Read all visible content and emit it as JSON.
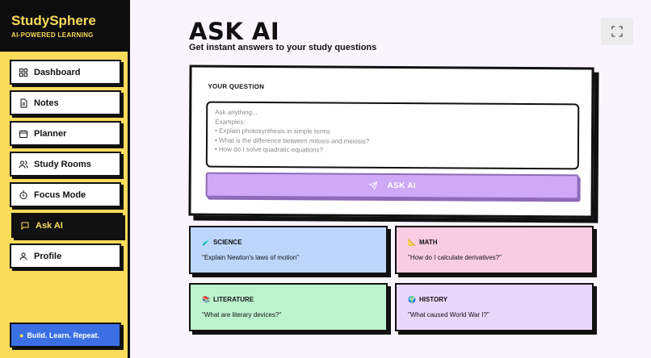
{
  "brand": {
    "name": "StudySphere",
    "tagline": "AI-POWERED LEARNING"
  },
  "sidebar": {
    "items": [
      {
        "label": "Dashboard",
        "icon": "grid-icon"
      },
      {
        "label": "Notes",
        "icon": "document-icon"
      },
      {
        "label": "Planner",
        "icon": "calendar-icon"
      },
      {
        "label": "Study Rooms",
        "icon": "users-icon"
      },
      {
        "label": "Focus Mode",
        "icon": "timer-icon"
      },
      {
        "label": "Ask AI",
        "icon": "chat-icon",
        "active": true
      },
      {
        "label": "Profile",
        "icon": "user-icon"
      }
    ],
    "motto": "Build. Learn. Repeat."
  },
  "header": {
    "title": "ASK AI",
    "subtitle": "Get instant answers to your study questions"
  },
  "question": {
    "label": "YOUR QUESTION",
    "placeholder": "Ask anything...\nExamples:\n• Explain photosynthesis in simple terms\n• What is the difference between mitosis and meiosis?\n• How do I solve quadratic equations?",
    "value": "",
    "button_label": "ASK AI"
  },
  "topics": [
    {
      "name": "SCIENCE",
      "icon": "test-tube-icon",
      "question": "\"Explain Newton's laws of motion\"",
      "color": "#bcd7fb"
    },
    {
      "name": "MATH",
      "icon": "triangle-ruler-icon",
      "question": "\"How do I calculate derivatives?\"",
      "color": "#f9cde1"
    },
    {
      "name": "LITERATURE",
      "icon": "books-icon",
      "question": "\"What are literary devices?\"",
      "color": "#bdf2cf"
    },
    {
      "name": "HISTORY",
      "icon": "globe-icon",
      "question": "\"What caused World War I?\"",
      "color": "#e9d6fb"
    }
  ],
  "colors": {
    "sidebar_bg": "#fbdb5b",
    "brand_bg": "#0d0d0d",
    "accent_purple": "#cfa8f6",
    "motto_blue": "#3b6fe3",
    "page_bg": "#faf5fd"
  }
}
